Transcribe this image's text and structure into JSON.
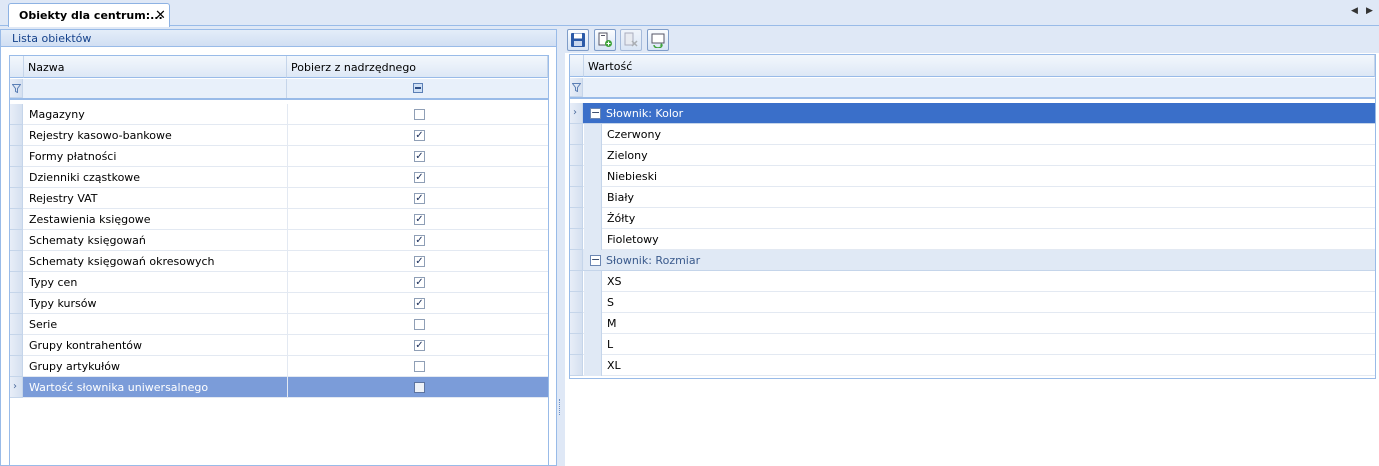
{
  "tab": {
    "title": "Obiekty dla centrum:...",
    "close": "✕"
  },
  "nav": {
    "left": "◀",
    "right": "▶"
  },
  "left_panel": {
    "title": "Lista obiektów",
    "columns": {
      "name": "Nazwa",
      "inherit": "Pobierz z nadrzędnego"
    },
    "rows": [
      {
        "name": "Magazyny",
        "checked": false,
        "selected": false
      },
      {
        "name": "Rejestry kasowo-bankowe",
        "checked": true,
        "selected": false
      },
      {
        "name": "Formy płatności",
        "checked": true,
        "selected": false
      },
      {
        "name": "Dzienniki cząstkowe",
        "checked": true,
        "selected": false
      },
      {
        "name": "Rejestry VAT",
        "checked": true,
        "selected": false
      },
      {
        "name": "Zestawienia księgowe",
        "checked": true,
        "selected": false
      },
      {
        "name": "Schematy księgowań",
        "checked": true,
        "selected": false
      },
      {
        "name": "Schematy księgowań okresowych",
        "checked": true,
        "selected": false
      },
      {
        "name": "Typy cen",
        "checked": true,
        "selected": false
      },
      {
        "name": "Typy kursów",
        "checked": true,
        "selected": false
      },
      {
        "name": "Serie",
        "checked": false,
        "selected": false
      },
      {
        "name": "Grupy kontrahentów",
        "checked": true,
        "selected": false
      },
      {
        "name": "Grupy artykułów",
        "checked": false,
        "selected": false
      },
      {
        "name": "Wartość słownika uniwersalnego",
        "checked": false,
        "selected": true
      }
    ]
  },
  "toolbar": {
    "buttons": [
      {
        "icon": "save-icon"
      },
      {
        "icon": "add-document-icon"
      },
      {
        "icon": "remove-document-icon"
      },
      {
        "icon": "refresh-icon"
      }
    ]
  },
  "right_panel": {
    "column": "Wartość",
    "groups": [
      {
        "label": "Słownik: Kolor",
        "selected": true,
        "items": [
          "Czerwony",
          "Zielony",
          "Niebieski",
          "Biały",
          "Żółty",
          "Fioletowy"
        ]
      },
      {
        "label": "Słownik: Rozmiar",
        "selected": false,
        "items": [
          "XS",
          "S",
          "M",
          "L",
          "XL"
        ]
      }
    ]
  },
  "colors": {
    "selected_row": "#7b9cd9",
    "selected_group": "#3a6fc9",
    "header_text": "#15428b"
  }
}
